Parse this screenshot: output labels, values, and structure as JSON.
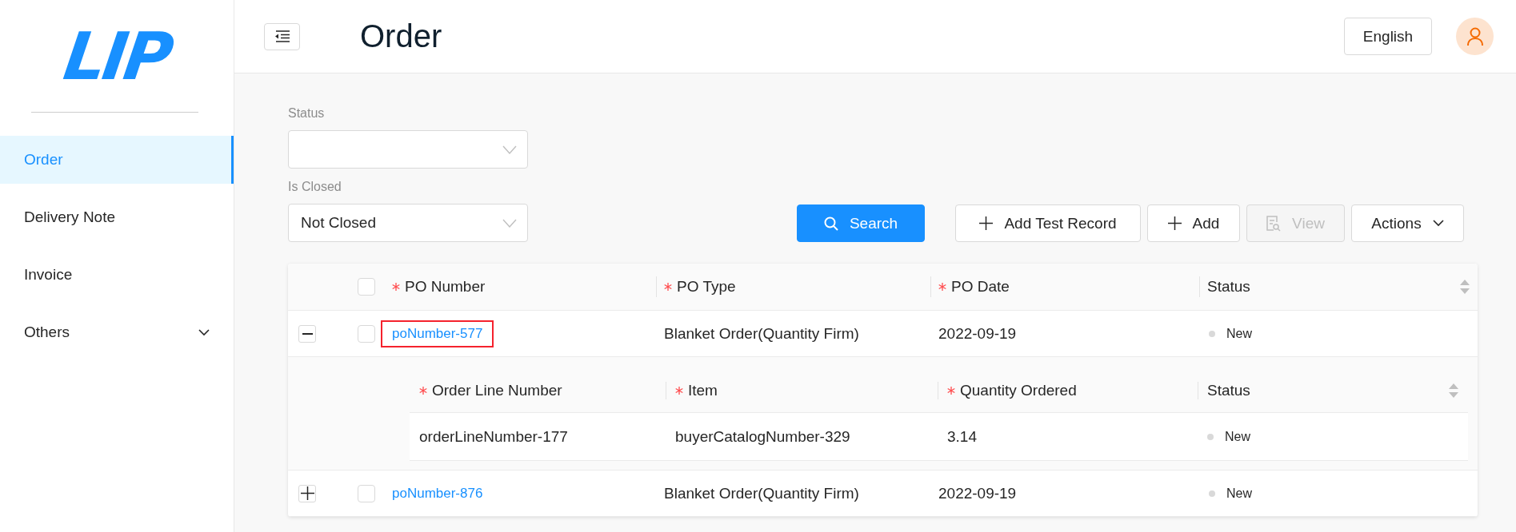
{
  "sidebar": {
    "logo": "LIP",
    "items": [
      {
        "label": "Order",
        "selected": true,
        "has_submenu": false
      },
      {
        "label": "Delivery Note",
        "selected": false,
        "has_submenu": false
      },
      {
        "label": "Invoice",
        "selected": false,
        "has_submenu": false
      },
      {
        "label": "Others",
        "selected": false,
        "has_submenu": true
      }
    ]
  },
  "header": {
    "title": "Order",
    "language": "English"
  },
  "filters": [
    {
      "label": "Status"
    },
    {
      "label": "Is Closed",
      "value": "Not Closed"
    }
  ],
  "toolbar": [
    {
      "label": "Search",
      "kind": "search",
      "disabled": false
    },
    {
      "label": "Add Test Record",
      "kind": "add",
      "disabled": false
    },
    {
      "label": "Add",
      "kind": "add",
      "disabled": false
    },
    {
      "label": "View",
      "kind": "view",
      "disabled": true
    },
    {
      "label": "Actions",
      "kind": "dropdown",
      "disabled": false
    }
  ],
  "table": {
    "header_checked": false,
    "columns": [
      {
        "label": "PO Number",
        "required": true,
        "sortable": false
      },
      {
        "label": "PO Type",
        "required": true,
        "sortable": false
      },
      {
        "label": "PO Date",
        "required": true,
        "sortable": false
      },
      {
        "label": "Status",
        "required": false,
        "sortable": true
      }
    ],
    "rows": [
      {
        "expanded": true,
        "checked": false,
        "highlighted": true,
        "cells": [
          "poNumber-577",
          "Blanket Order(Quantity Firm)",
          "2022-09-19"
        ],
        "status": {
          "label": "New",
          "color": "#d9d9d9"
        },
        "lines": {
          "columns": [
            {
              "label": "Order Line Number",
              "required": true,
              "sortable": false
            },
            {
              "label": "Item",
              "required": true,
              "sortable": false
            },
            {
              "label": "Quantity Ordered",
              "required": true,
              "sortable": false
            },
            {
              "label": "Status",
              "required": false,
              "sortable": true
            }
          ],
          "rows": [
            {
              "cells": [
                "orderLineNumber-177",
                "buyerCatalogNumber-329",
                "3.14"
              ],
              "status": {
                "label": "New",
                "color": "#d9d9d9"
              }
            }
          ]
        }
      },
      {
        "expanded": false,
        "checked": false,
        "highlighted": false,
        "cells": [
          "poNumber-876",
          "Blanket Order(Quantity Firm)",
          "2022-09-19"
        ],
        "status": {
          "label": "New",
          "color": "#d9d9d9"
        }
      }
    ]
  }
}
